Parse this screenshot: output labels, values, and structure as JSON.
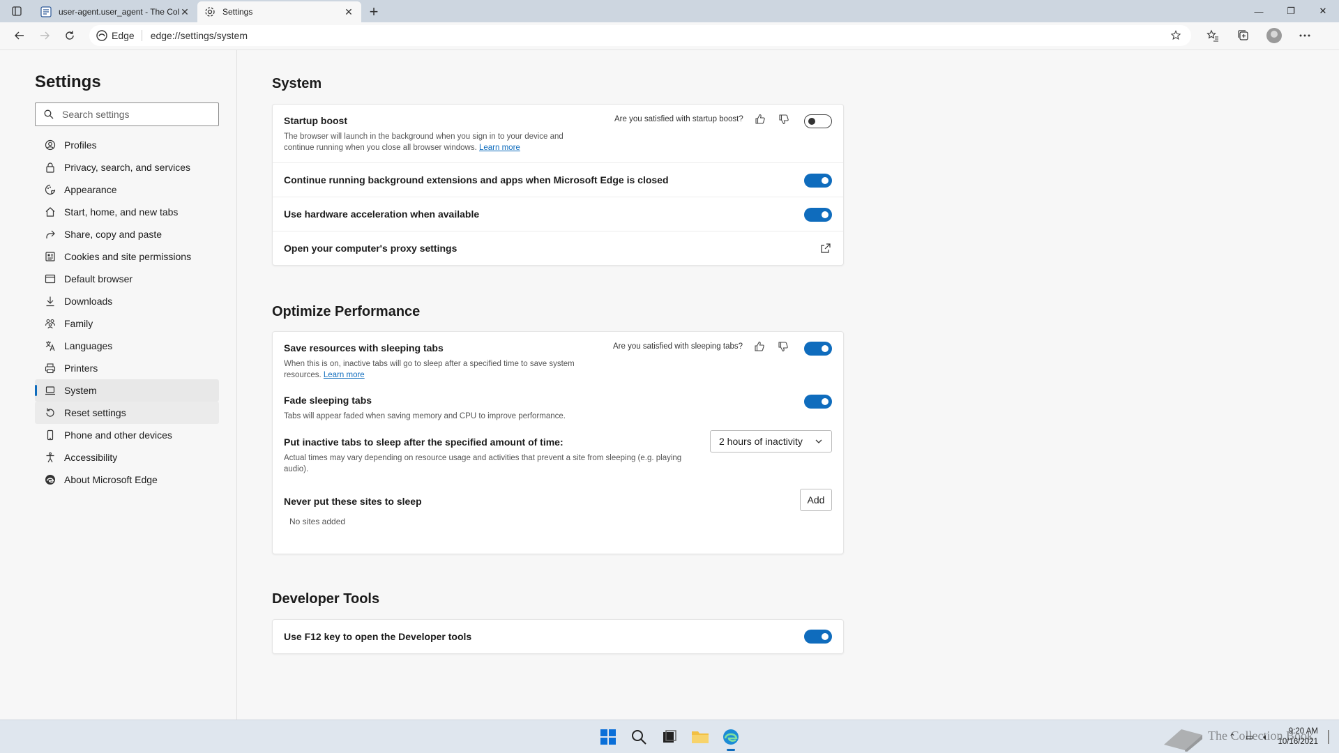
{
  "tabs": [
    {
      "title": "user-agent.user_agent - The Coll",
      "icon": "page-icon",
      "active": false
    },
    {
      "title": "Settings",
      "icon": "gear-icon",
      "active": true
    }
  ],
  "address": {
    "site_label": "Edge",
    "url": "edge://settings/system"
  },
  "sidebar": {
    "title": "Settings",
    "search_placeholder": "Search settings",
    "items": [
      {
        "label": "Profiles",
        "icon": "profile-icon"
      },
      {
        "label": "Privacy, search, and services",
        "icon": "lock-icon"
      },
      {
        "label": "Appearance",
        "icon": "appearance-icon"
      },
      {
        "label": "Start, home, and new tabs",
        "icon": "home-icon"
      },
      {
        "label": "Share, copy and paste",
        "icon": "share-icon"
      },
      {
        "label": "Cookies and site permissions",
        "icon": "cookies-icon"
      },
      {
        "label": "Default browser",
        "icon": "browser-icon"
      },
      {
        "label": "Downloads",
        "icon": "download-icon"
      },
      {
        "label": "Family",
        "icon": "family-icon"
      },
      {
        "label": "Languages",
        "icon": "languages-icon"
      },
      {
        "label": "Printers",
        "icon": "printer-icon"
      },
      {
        "label": "System",
        "icon": "laptop-icon",
        "selected": true
      },
      {
        "label": "Reset settings",
        "icon": "reset-icon",
        "hover": true
      },
      {
        "label": "Phone and other devices",
        "icon": "phone-icon"
      },
      {
        "label": "Accessibility",
        "icon": "accessibility-icon"
      },
      {
        "label": "About Microsoft Edge",
        "icon": "edge-icon"
      }
    ]
  },
  "system": {
    "title": "System",
    "startup_boost": {
      "title": "Startup boost",
      "desc1": "The browser will launch in the background when you sign in to your device and",
      "desc2": "continue running when you close all browser windows.",
      "learn_more": "Learn more",
      "feedback": "Are you satisfied with startup boost?",
      "enabled": false
    },
    "background": {
      "title": "Continue running background extensions and apps when Microsoft Edge is closed",
      "enabled": true
    },
    "hardware": {
      "title": "Use hardware acceleration when available",
      "enabled": true
    },
    "proxy": {
      "title": "Open your computer's proxy settings"
    }
  },
  "performance": {
    "title": "Optimize Performance",
    "sleeping_tabs": {
      "title": "Save resources with sleeping tabs",
      "desc1": "When this is on, inactive tabs will go to sleep after a specified time to save system",
      "desc2": "resources.",
      "learn_more": "Learn more",
      "feedback": "Are you satisfied with sleeping tabs?",
      "enabled": true
    },
    "fade": {
      "title": "Fade sleeping tabs",
      "desc": "Tabs will appear faded when saving memory and CPU to improve performance.",
      "enabled": true
    },
    "inactive": {
      "title": "Put inactive tabs to sleep after the specified amount of time:",
      "desc1": "Actual times may vary depending on resource usage and activities that prevent a site from sleeping (e.g. playing",
      "desc2": "audio).",
      "selected": "2 hours of inactivity"
    },
    "never_sleep": {
      "title": "Never put these sites to sleep",
      "add_label": "Add",
      "empty_text": "No sites added"
    }
  },
  "devtools": {
    "title": "Developer Tools",
    "f12": {
      "title": "Use F12 key to open the Developer tools",
      "enabled": true
    }
  },
  "taskbar": {
    "time": "9:20 AM",
    "date": "10/16/2021",
    "apps": [
      "start-icon",
      "search-icon",
      "task-view-icon",
      "file-explorer-icon",
      "edge-icon"
    ]
  },
  "watermark": "The Collection Book",
  "colors": {
    "accent": "#0f6cbd",
    "tabbar": "#cdd6e0",
    "page": "#f7f7f7"
  }
}
